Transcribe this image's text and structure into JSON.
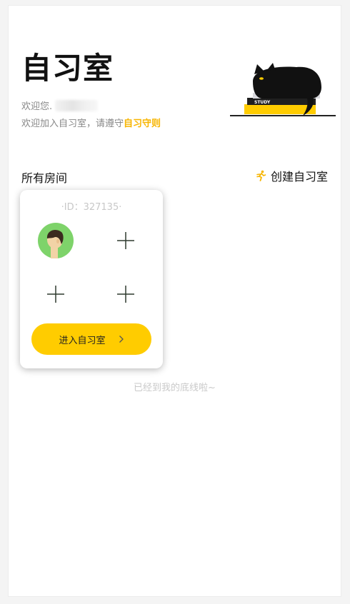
{
  "header": {
    "title": "自习室",
    "welcome_prefix": "欢迎您.",
    "rules_prefix": "欢迎加入自习室，请遵守",
    "rules_link": "自习守则"
  },
  "illustration": {
    "book_label": "STUDY",
    "icon": "black-cat-on-books"
  },
  "rooms": {
    "section_title": "所有房间",
    "create_label": "创建自习室",
    "create_icon": "running-person-icon",
    "cards": [
      {
        "id_text": "·ID：327135·",
        "slots": [
          "avatar",
          "plus",
          "plus",
          "plus"
        ],
        "enter_label": "进入自习室",
        "enter_icon": "chevron-right-icon"
      }
    ]
  },
  "footer": {
    "note": "已经到我的底线啦~"
  },
  "colors": {
    "accent": "#ffcc00",
    "link": "#f7b500",
    "avatar_bg": "#7ed36a"
  }
}
